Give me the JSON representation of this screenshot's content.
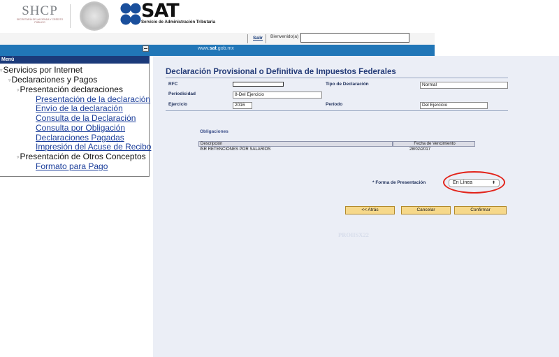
{
  "header": {
    "shcp_logo": "SHCP",
    "shcp_subtitle": "SECRETARÍA DE HACIENDA Y CRÉDITO PÚBLICO",
    "sat_logo": "SAT",
    "sat_subtitle": "Servicio de Administración Tributaria",
    "salir_link": "Salir",
    "bienvenido_label": "Bienvenido(a)",
    "user_value": "",
    "site_url_prefix": "www.",
    "site_url_bold": "sat",
    "site_url_suffix": ".gob.mx"
  },
  "sidebar": {
    "menu_title": "Menú",
    "items": [
      {
        "label": "Servicios por Internet"
      },
      {
        "label": "Declaraciones y Pagos"
      },
      {
        "label": "Presentación declaraciones"
      },
      {
        "label": "Presentación de la declaración"
      },
      {
        "label": "Envío de la declaración"
      },
      {
        "label": "Consulta de la Declaración"
      },
      {
        "label": "Consulta por Obligación"
      },
      {
        "label": "Declaraciones Pagadas"
      },
      {
        "label": "Impresión del Acuse de Recibo"
      },
      {
        "label": "Presentación de Otros Conceptos"
      },
      {
        "label": "Formato para Pago"
      }
    ]
  },
  "form": {
    "title": "Declaración Provisional o Definitiva de Impuestos Federales",
    "rfc_label": "RFC",
    "rfc_value": "",
    "periodicidad_label": "Periodicidad",
    "periodicidad_value": "8-Del Ejercicio",
    "ejercicio_label": "Ejercicio",
    "ejercicio_value": "2016",
    "tipo_label": "Tipo de Declaración",
    "tipo_value": "Normal",
    "periodo_label": "Período",
    "periodo_value": "Del Ejercicio"
  },
  "obligaciones": {
    "title": "Obligaciones",
    "columns": [
      "Descripción",
      "Fecha de Vencimiento"
    ],
    "rows": [
      {
        "descripcion": "ISR RETENCIONES POR SALARIOS",
        "fecha": "28/02/2017"
      }
    ]
  },
  "presentacion": {
    "label": "* Forma de Presentación",
    "selected": "En Línea",
    "highlight_color": "#e2231a"
  },
  "buttons": {
    "atras": "<< Atrás",
    "cancelar": "Cancelar",
    "confirmar": "Confirmar"
  },
  "page_code": "PROIISX22",
  "colors": {
    "menu_bar": "#1b3a7a",
    "site_bar": "#2176b7",
    "content_bg": "#ebeef6",
    "title": "#263d79",
    "button_bg": "#f6d88a"
  }
}
